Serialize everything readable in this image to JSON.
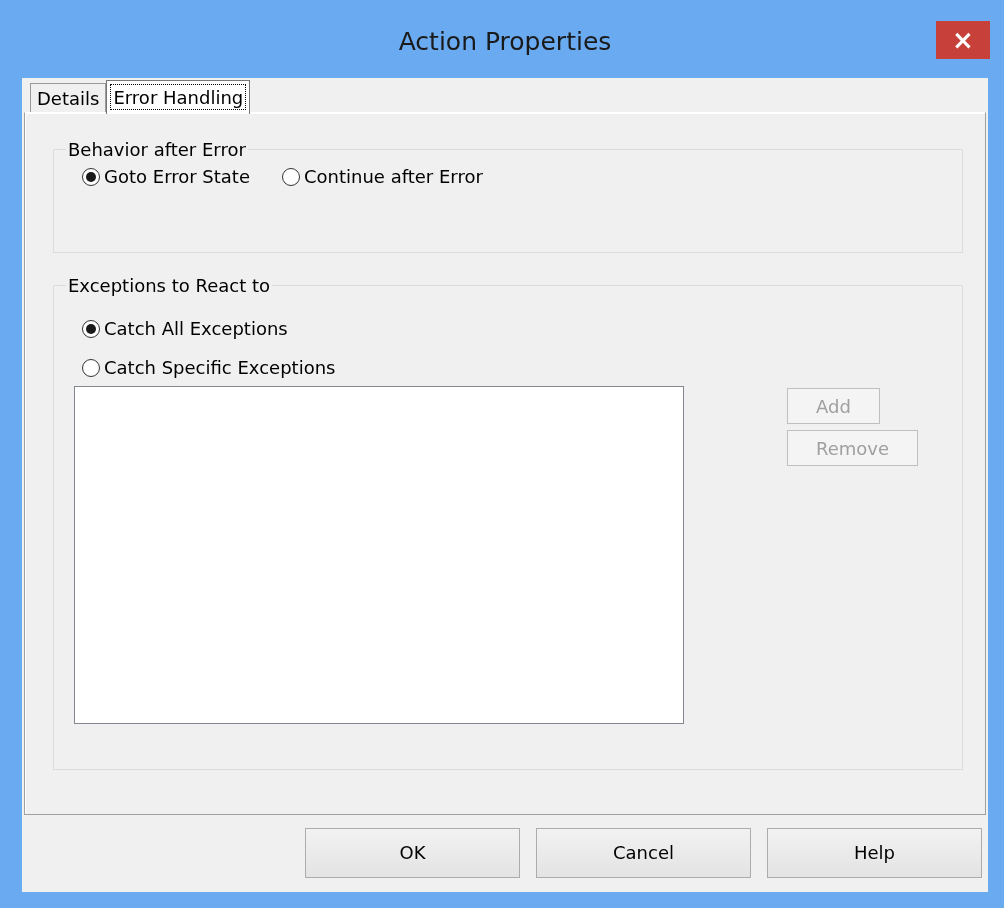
{
  "window": {
    "title": "Action Properties",
    "close": "×"
  },
  "tabs": [
    {
      "label": "Details",
      "selected": false
    },
    {
      "label": "Error Handling",
      "selected": true
    }
  ],
  "behavior_group": {
    "title": "Behavior after Error",
    "options": [
      {
        "label": "Goto Error State",
        "selected": true
      },
      {
        "label": "Continue after Error",
        "selected": false
      }
    ]
  },
  "exceptions_group": {
    "title": "Exceptions to React to",
    "options": [
      {
        "label": "Catch All Exceptions",
        "selected": true
      },
      {
        "label": "Catch Specific Exceptions",
        "selected": false
      }
    ],
    "buttons": [
      {
        "label": "Add",
        "disabled": true
      },
      {
        "label": "Remove",
        "disabled": true
      }
    ]
  },
  "buttons": [
    {
      "label": "OK",
      "disabled": false
    },
    {
      "label": "Cancel",
      "disabled": false
    },
    {
      "label": "Help",
      "disabled": false
    }
  ]
}
